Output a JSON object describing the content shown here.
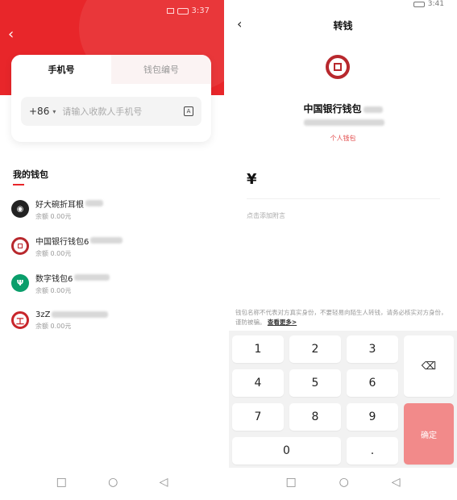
{
  "left": {
    "status_time": "3:37",
    "back_icon": "back-chevron-icon",
    "tabs": [
      {
        "label": "手机号",
        "active": true
      },
      {
        "label": "钱包编号",
        "active": false
      }
    ],
    "country_code": "+86",
    "phone_placeholder": "请输入收款人手机号",
    "my_wallet_title": "我的钱包",
    "wallets": [
      {
        "name": "好大碗折耳根",
        "balance": "余额 0.00元",
        "icon": "penguin-icon",
        "color": "#222222"
      },
      {
        "name": "中国银行钱包6",
        "balance": "余额 0.00元",
        "icon": "boc-logo-icon",
        "color": "#b8282d"
      },
      {
        "name": "数字钱包6",
        "balance": "余额 0.00元",
        "icon": "abc-logo-icon",
        "color": "#0a9e6b"
      },
      {
        "name": "3zZ",
        "balance": "余额 0.00元",
        "icon": "icbc-logo-icon",
        "color": "#c8262b"
      }
    ]
  },
  "right": {
    "status_time": "3:41",
    "title": "转钱",
    "wallet_name": "中国银行钱包",
    "wallet_type": "个人钱包",
    "currency_symbol": "¥",
    "memo_placeholder": "点击添加附言",
    "warning_text": "钱包名称不代表对方真实身份，不要轻易向陌生人转钱，请务必核实对方身份，谨防被骗。",
    "warning_more": "查看更多>",
    "keys": [
      "1",
      "2",
      "3",
      "4",
      "5",
      "6",
      "7",
      "8",
      "9",
      "0",
      "."
    ],
    "confirm_label": "确定",
    "delete_icon": "backspace-icon"
  },
  "nav": {
    "square": "□",
    "circle": "○",
    "triangle": "◁"
  }
}
